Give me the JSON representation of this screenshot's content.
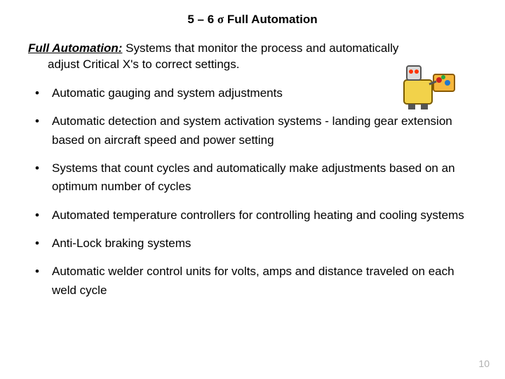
{
  "title": {
    "prefix": "5 – 6 ",
    "sigma": "σ",
    "suffix": " Full Automation"
  },
  "definition": {
    "term": "Full Automation:",
    "body_line1": "  Systems that monitor the process and automatically",
    "body_line2": "adjust Critical X's to correct settings."
  },
  "bullets": [
    "Automatic gauging and system adjustments",
    "Automatic detection and system activation systems - landing gear extension based on aircraft speed and power setting",
    "Systems that count cycles and automatically make adjustments based on an optimum number of cycles",
    "Automated temperature controllers for controlling heating and cooling systems",
    "Anti-Lock braking systems",
    "Automatic welder control units for volts, amps and distance traveled on each weld cycle"
  ],
  "page_number": "10",
  "clipart_alt": "cartoon robot holding box"
}
